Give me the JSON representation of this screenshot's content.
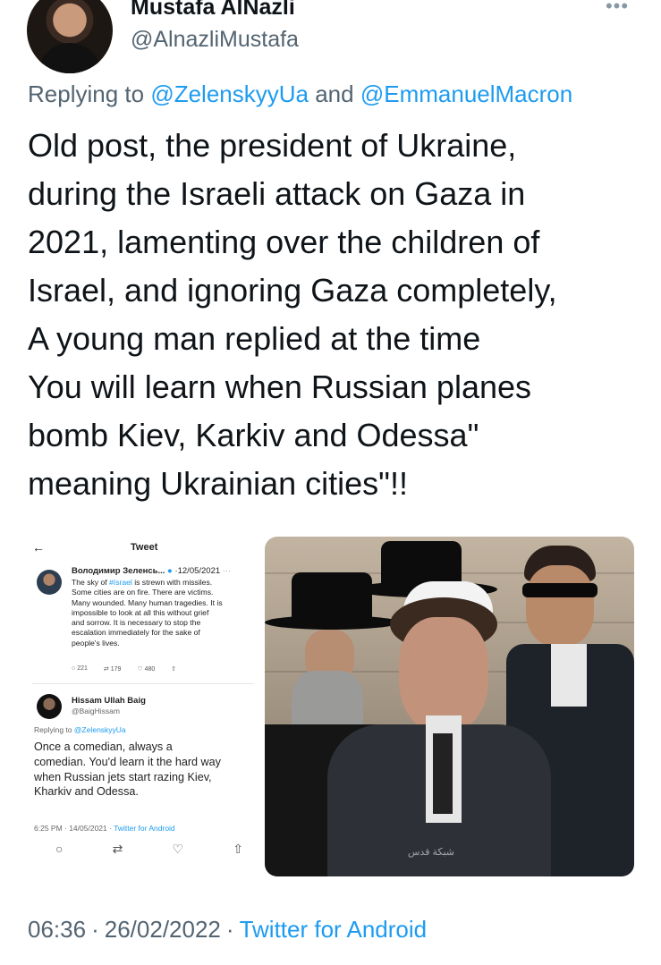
{
  "author": {
    "display_name": "Mustafa AlNazli",
    "handle": "@AlnazliMustafa",
    "more_icon": "more-horizontal-icon"
  },
  "reply_context": {
    "prefix": "Replying to",
    "mention1": "@ZelenskyyUa",
    "conjunction": "and",
    "mention2": "@EmmanuelMacron"
  },
  "tweet": {
    "text": "Old post, the president of Ukraine,\nduring the Israeli attack on Gaza in\n2021, lamenting over the children of\nIsrael, and ignoring Gaza completely,\nA young man replied at the time\n You will learn when Russian planes\nbomb Kiev, Karkiv and Odessa\"\nmeaning  Ukrainian cities\"!!"
  },
  "embedded_screenshot": {
    "back_icon": "arrow-left-icon",
    "title": "Tweet",
    "original": {
      "name": "Володимир Зеленсь...",
      "date": "12/05/2021",
      "text_before_tag": "The sky of ",
      "hashtag": "#Israel",
      "text_after_tag": " is strewn with missiles.\nSome cities are on fire. There are victims.\nMany wounded. Many human tragedies. It is\nimpossible to look at all this without grief\nand sorrow. It is necessary to stop the\nescalation immediately for the sake of\npeople's lives.",
      "replies": "221",
      "retweets": "179",
      "likes": "480"
    },
    "reply": {
      "name": "Hissam Ullah Baig",
      "handle": "@BaigHissam",
      "replying_prefix": "Replying to",
      "replying_mention": "@ZelenskyyUa",
      "text": "Once a comedian, always a\ncomedian. You'd learn it the hard way\nwhen Russian jets start razing Kiev,\nKharkiv and Odessa.",
      "timestamp": "6:25 PM · 14/05/2021 · ",
      "source": "Twitter for Android"
    }
  },
  "photo": {
    "watermark": "شبكة قدس"
  },
  "footer": {
    "time": "06:36",
    "separator": "·",
    "date": "26/02/2022",
    "source": "Twitter for Android"
  },
  "colors": {
    "link": "#1d9bf0",
    "secondary_text": "#536471",
    "primary_text": "#0f1419"
  }
}
